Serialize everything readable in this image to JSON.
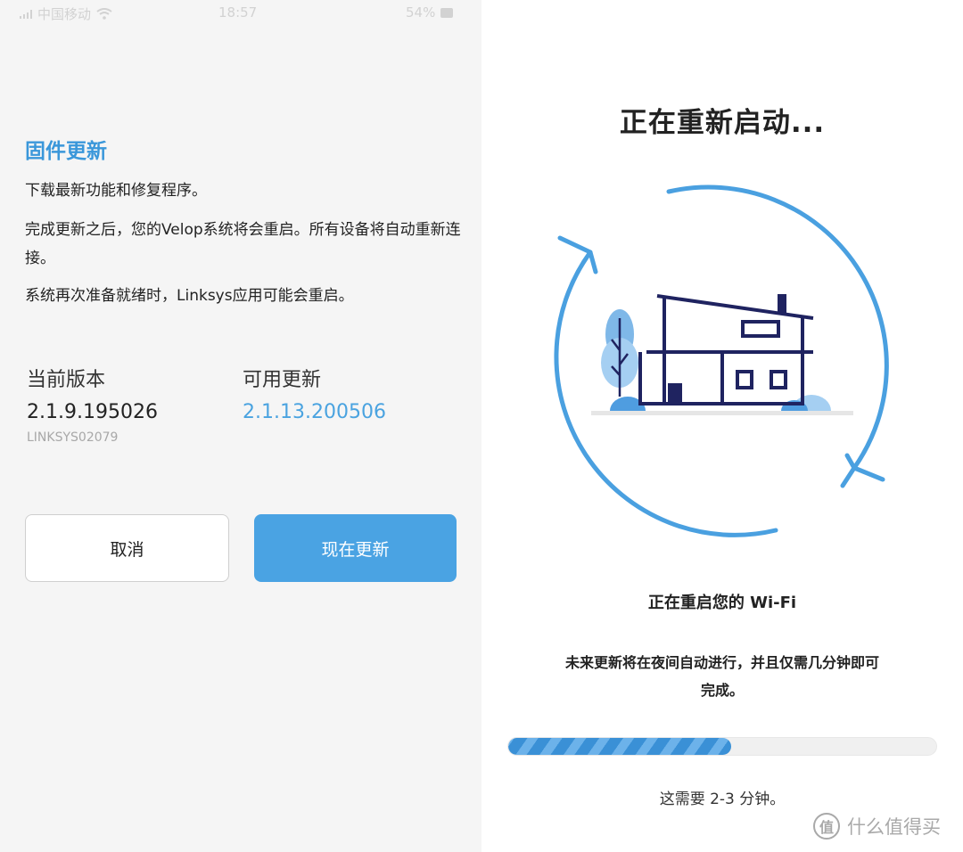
{
  "status_bar": {
    "carrier": "中国移动",
    "time": "18:57",
    "battery": "54%",
    "wifi_icon": "wifi-icon"
  },
  "firmware": {
    "title": "固件更新",
    "line1": "下载最新功能和修复程序。",
    "line2": "完成更新之后，您的Velop系统将会重启。所有设备将自动重新连接。",
    "line3": "系统再次准备就绪时，Linksys应用可能会重启。",
    "current_label": "当前版本",
    "current_value": "2.1.9.195026",
    "serial": "LINKSYS02079",
    "available_label": "可用更新",
    "available_value": "2.1.13.200506",
    "cancel_label": "取消",
    "update_label": "现在更新"
  },
  "reboot": {
    "title": "正在重新启动...",
    "subtitle": "正在重启您的 Wi-Fi",
    "note": "未来更新将在夜间自动进行，并且仅需几分钟即可完成。",
    "progress": 0.52,
    "time_note": "这需要 2-3 分钟。"
  },
  "watermark": {
    "icon_text": "值",
    "text": "什么值得买"
  },
  "colors": {
    "accent": "#3a97da",
    "button_blue": "#4aa3e3",
    "navy": "#1f2360",
    "panel_bg": "#f5f5f5"
  }
}
